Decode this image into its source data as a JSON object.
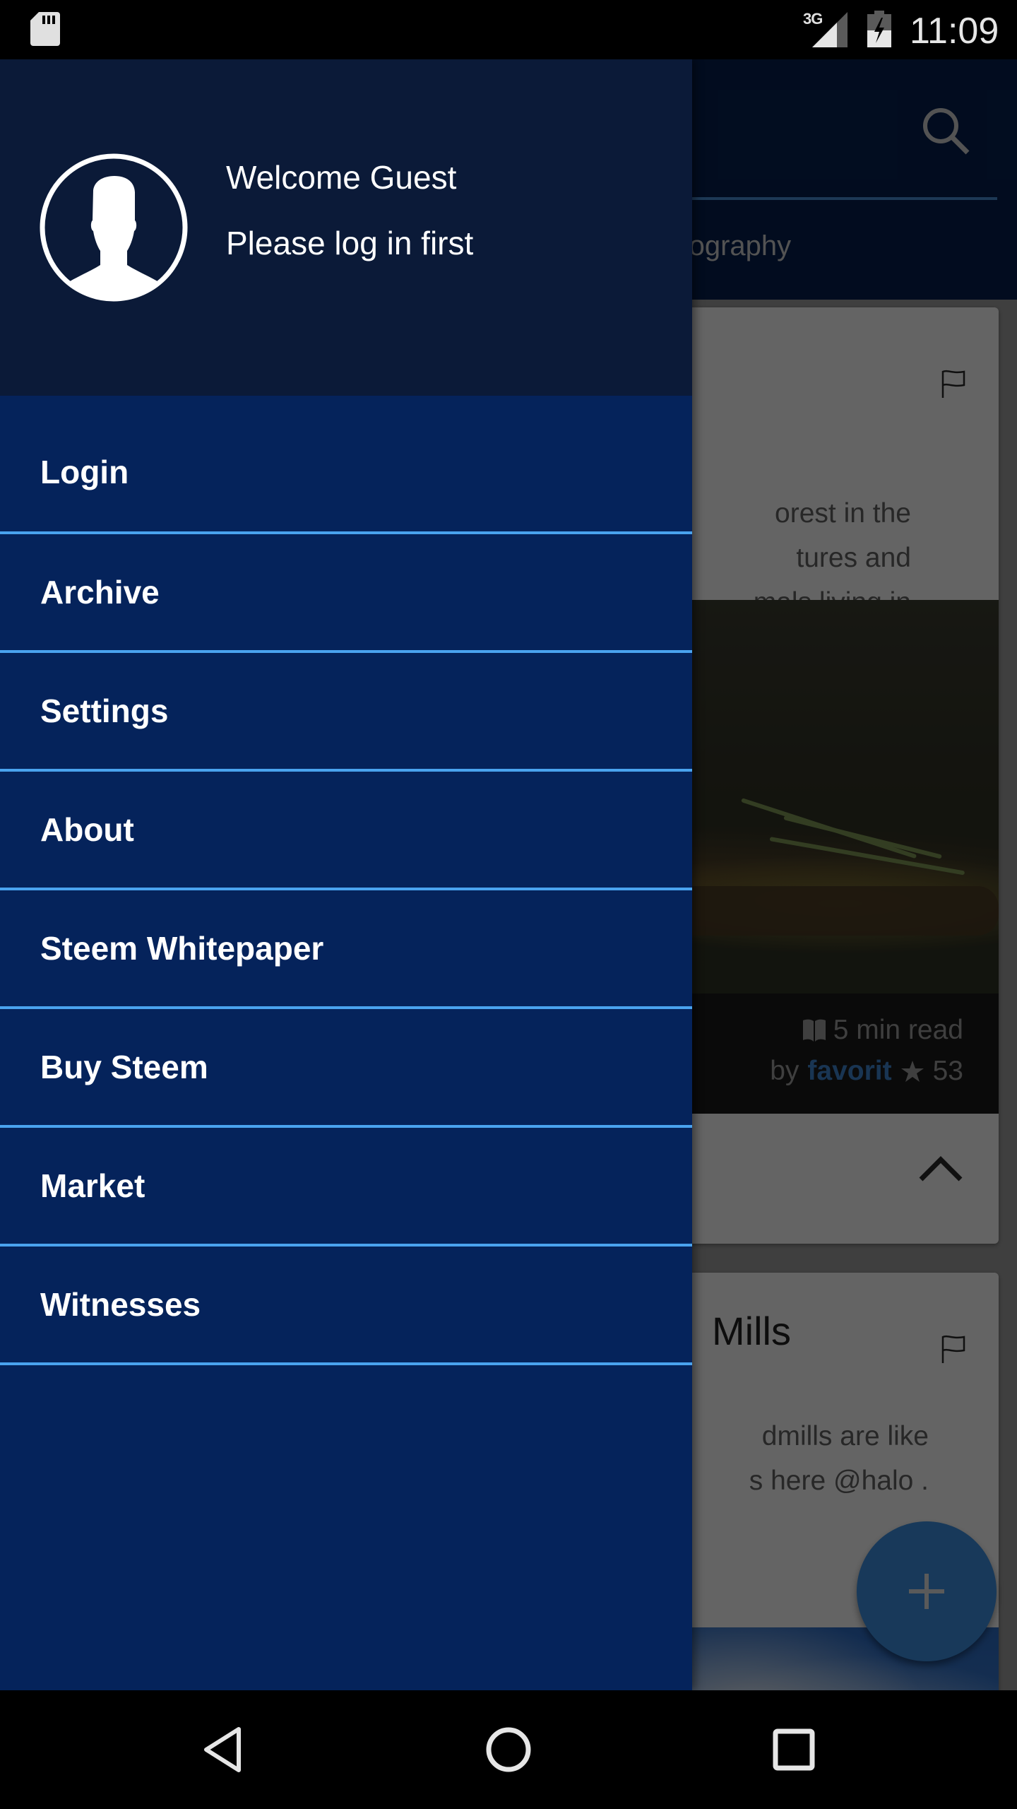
{
  "status_bar": {
    "time": "11:09",
    "network_type": "3G",
    "icons": [
      "sd-card-icon",
      "signal-icon",
      "battery-charging-icon"
    ],
    "signal_level": 0.75,
    "battery_level": 0.5,
    "battery_charging": true
  },
  "background_app": {
    "toolbar": {
      "search_icon": "search-icon"
    },
    "tab_partial_label": "hotography",
    "cards": [
      {
        "title": "",
        "excerpt_lines": [
          "orest in the",
          "tures and",
          "mals living in"
        ],
        "read_time": "5 min read",
        "by_label": "by",
        "author": "favorit",
        "reputation": "53",
        "flag_icon": "flag-icon",
        "collapse_icon": "chevron-up-icon"
      },
      {
        "title": "Mills",
        "excerpt_lines": [
          "dmills are like",
          "s here @halo ."
        ],
        "flag_icon": "flag-icon"
      }
    ],
    "fab": {
      "icon": "plus-icon",
      "label": "+"
    }
  },
  "drawer": {
    "header": {
      "avatar_icon": "user-avatar-icon",
      "welcome": "Welcome Guest",
      "prompt": "Please log in first"
    },
    "items": [
      {
        "label": "Login"
      },
      {
        "label": "Archive"
      },
      {
        "label": "Settings"
      },
      {
        "label": "About"
      },
      {
        "label": "Steem Whitepaper"
      },
      {
        "label": "Buy Steem"
      },
      {
        "label": "Market"
      },
      {
        "label": "Witnesses"
      }
    ]
  },
  "nav_bar": {
    "back": "back-icon",
    "home": "home-icon",
    "recents": "recents-icon"
  },
  "colors": {
    "drawer_header_bg": "#0b1a38",
    "drawer_bg": "#05235b",
    "divider": "#4aa3ef",
    "author_link": "#3f86cf",
    "fab": "#3c8fe0"
  }
}
